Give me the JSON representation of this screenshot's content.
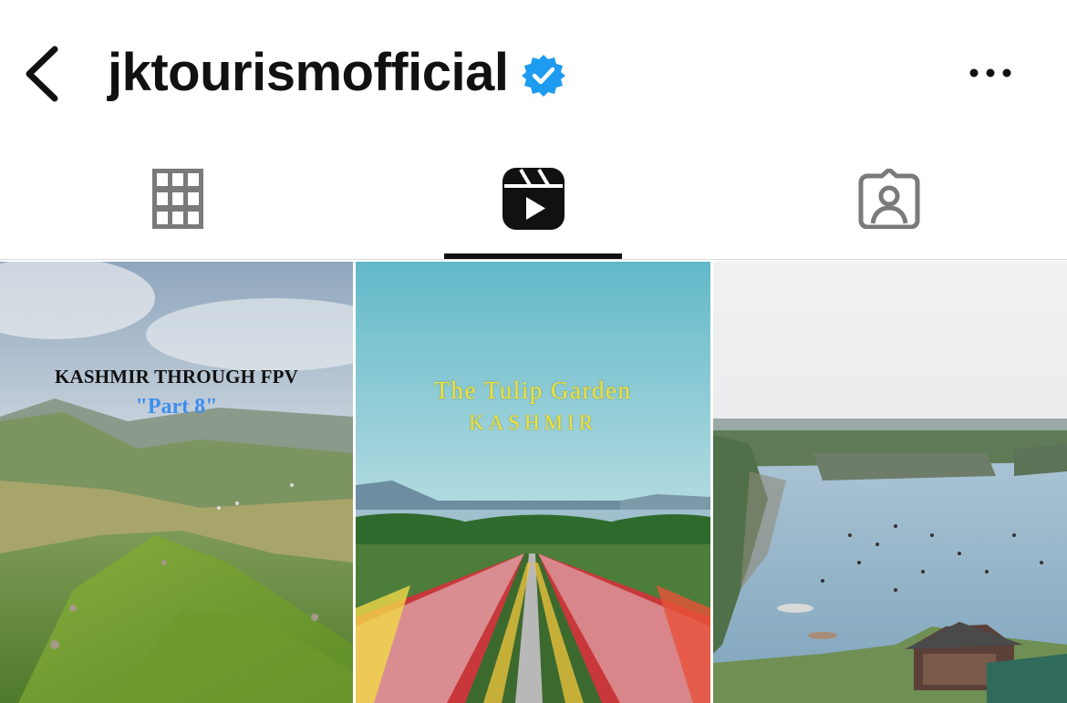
{
  "header": {
    "username": "jktourismofficial",
    "verified": true,
    "back_icon": "chevron-left-icon",
    "more_icon": "ellipsis-horizontal-icon",
    "verified_color": "#1d9bf0"
  },
  "tabs": [
    {
      "name": "posts-grid",
      "icon": "grid-icon",
      "active": false
    },
    {
      "name": "reels",
      "icon": "reels-icon",
      "active": true
    },
    {
      "name": "tagged",
      "icon": "tagged-person-icon",
      "active": false
    }
  ],
  "reels": [
    {
      "caption_line1": "KASHMIR THROUGH FPV",
      "caption_line2": "\"Part 8\""
    },
    {
      "caption_line1": "The Tulip Garden",
      "caption_line2": "KASHMIR"
    },
    {
      "caption_line1": "",
      "caption_line2": ""
    }
  ]
}
